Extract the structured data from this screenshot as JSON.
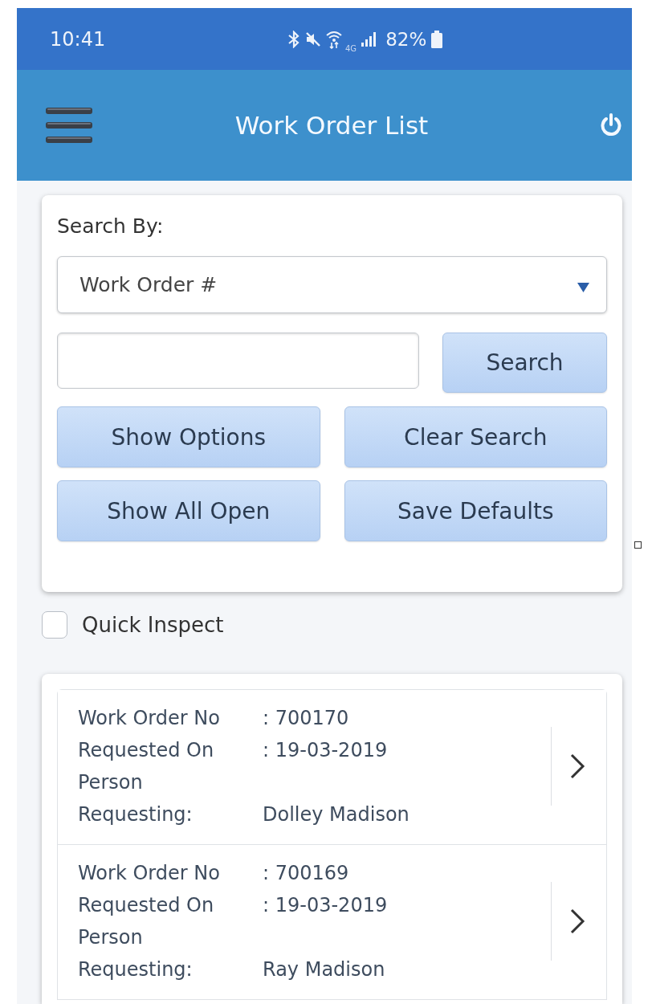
{
  "status_bar": {
    "time": "10:41",
    "network": "4G",
    "battery": "82%"
  },
  "app_bar": {
    "title": "Work Order List"
  },
  "search_panel": {
    "label": "Search By:",
    "search_by": {
      "value": "Work Order #"
    },
    "search_button": "Search",
    "actions": [
      "Show Options",
      "Clear Search",
      "Show All Open",
      "Save Defaults"
    ]
  },
  "quick_inspect": {
    "label": "Quick Inspect",
    "checked": false
  },
  "work_orders": [
    {
      "fields": [
        {
          "label": "Work Order No",
          "value": ": 700170"
        },
        {
          "label": "Requested On",
          "value": ": 19-03-2019"
        },
        {
          "label": "Person Requesting:",
          "value": "Dolley Madison"
        }
      ]
    },
    {
      "fields": [
        {
          "label": "Work Order No",
          "value": ": 700169"
        },
        {
          "label": "Requested On",
          "value": ": 19-03-2019"
        },
        {
          "label": "Person Requesting:",
          "value": "Ray Madison"
        }
      ]
    }
  ]
}
